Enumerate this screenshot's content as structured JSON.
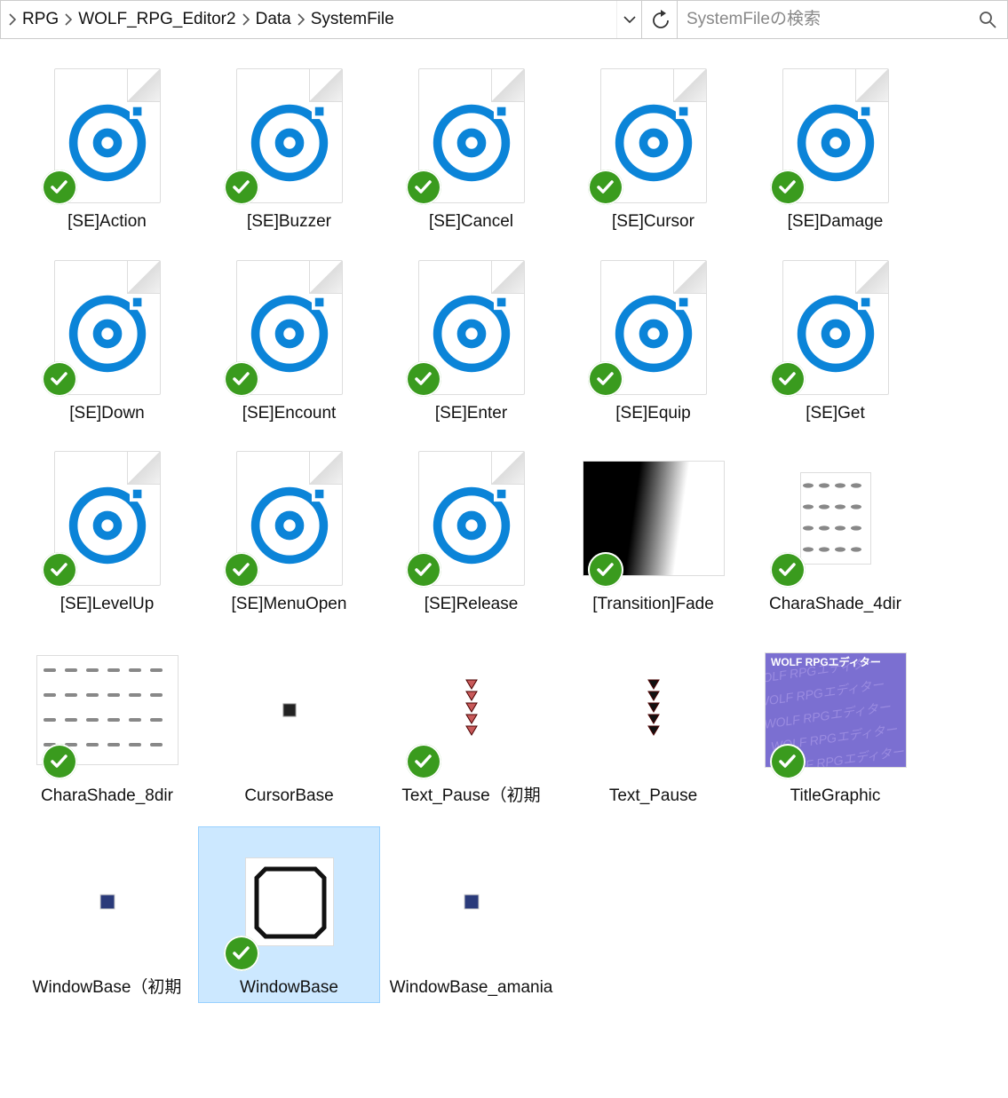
{
  "breadcrumb": [
    "RPG",
    "WOLF_RPG_Editor2",
    "Data",
    "SystemFile"
  ],
  "search": {
    "placeholder": "SystemFileの検索"
  },
  "items": [
    {
      "type": "audio",
      "badge": true,
      "name": "[SE]Action"
    },
    {
      "type": "audio",
      "badge": true,
      "name": "[SE]Buzzer"
    },
    {
      "type": "audio",
      "badge": true,
      "name": "[SE]Cancel"
    },
    {
      "type": "audio",
      "badge": true,
      "name": "[SE]Cursor"
    },
    {
      "type": "audio",
      "badge": true,
      "name": "[SE]Damage"
    },
    {
      "type": "audio",
      "badge": true,
      "name": "[SE]Down"
    },
    {
      "type": "audio",
      "badge": true,
      "name": "[SE]Encount"
    },
    {
      "type": "audio",
      "badge": true,
      "name": "[SE]Enter"
    },
    {
      "type": "audio",
      "badge": true,
      "name": "[SE]Equip"
    },
    {
      "type": "audio",
      "badge": true,
      "name": "[SE]Get"
    },
    {
      "type": "audio",
      "badge": true,
      "name": "[SE]LevelUp"
    },
    {
      "type": "audio",
      "badge": true,
      "name": "[SE]MenuOpen"
    },
    {
      "type": "audio",
      "badge": true,
      "name": "[SE]Release"
    },
    {
      "type": "fade",
      "badge": true,
      "name": "[Transition]Fade"
    },
    {
      "type": "shade4",
      "badge": true,
      "name": "CharaShade_4dir"
    },
    {
      "type": "shade8",
      "badge": true,
      "name": "CharaShade_8dir"
    },
    {
      "type": "cursor",
      "badge": false,
      "name": "CursorBase"
    },
    {
      "type": "pauseR",
      "badge": true,
      "name": "Text_Pause（初期"
    },
    {
      "type": "pauseB",
      "badge": false,
      "name": "Text_Pause"
    },
    {
      "type": "title",
      "badge": true,
      "name": "TitleGraphic"
    },
    {
      "type": "wblue",
      "badge": false,
      "name": "WindowBase（初期"
    },
    {
      "type": "woct",
      "badge": true,
      "name": "WindowBase",
      "selected": true
    },
    {
      "type": "wblue2",
      "badge": false,
      "name": "WindowBase_amania"
    }
  ]
}
